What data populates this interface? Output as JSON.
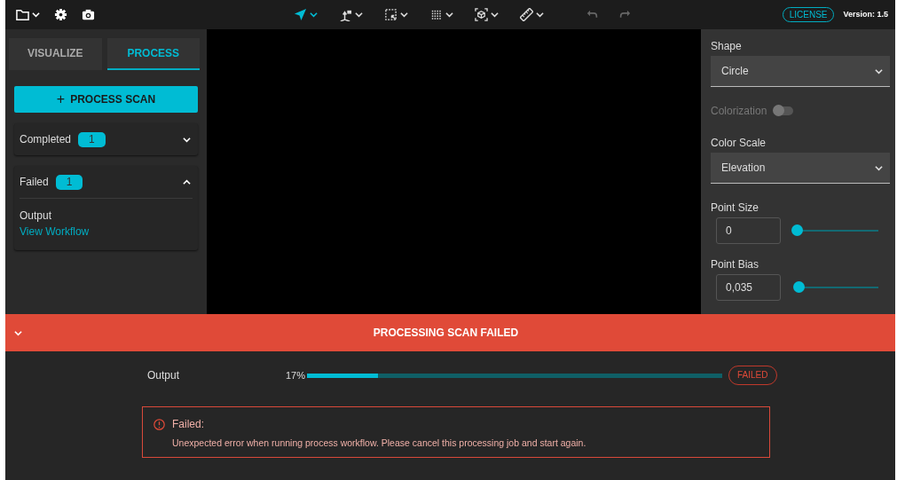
{
  "toolbar": {
    "left_tools": [
      {
        "kind": "folder"
      },
      {
        "kind": "gear"
      },
      {
        "kind": "camera"
      }
    ],
    "center_tools": [
      {
        "kind": "pointer",
        "selected": true
      },
      {
        "kind": "transform",
        "selected": false
      },
      {
        "kind": "selection",
        "selected": false
      },
      {
        "kind": "grid",
        "selected": false
      },
      {
        "kind": "cube",
        "selected": false
      },
      {
        "kind": "ruler",
        "selected": false
      }
    ],
    "history": [
      {
        "kind": "undo",
        "disabled": true
      },
      {
        "kind": "redo",
        "disabled": true
      }
    ],
    "license_button": "LICENSE",
    "version": "Version: 1.5"
  },
  "tabs": [
    {
      "label": "VISUALIZE",
      "selected": false
    },
    {
      "label": "PROCESS",
      "selected": true
    }
  ],
  "process_button": {
    "icon": "+",
    "label": "PROCESS SCAN"
  },
  "groups": [
    {
      "label": "Completed",
      "count": "1",
      "expanded": false
    },
    {
      "label": "Failed",
      "count": "1",
      "expanded": true,
      "items": [
        {
          "label": "Output",
          "link": "View Workflow"
        }
      ]
    }
  ],
  "settings": [
    {
      "kind": "select",
      "label": "Shape",
      "value": "Circle"
    },
    {
      "kind": "toggle",
      "label": "Colorization",
      "on": false,
      "disabled": true
    },
    {
      "kind": "select",
      "label": "Color Scale",
      "value": "Elevation"
    },
    {
      "kind": "slider",
      "label": "Point Size",
      "value": "0",
      "level": 0
    },
    {
      "kind": "slider",
      "label": "Point Bias",
      "value": "0,035",
      "level": 0.02
    }
  ],
  "status_panel": {
    "expanded": true,
    "title": "PROCESSING SCAN FAILED",
    "jobs": [
      {
        "label": "Output",
        "percent": "17%",
        "level": 0.17,
        "status": "FAILED"
      }
    ],
    "error": {
      "title": "Failed:",
      "message": "Unexpected error when running process workflow. Please cancel this processing job and start again."
    }
  }
}
